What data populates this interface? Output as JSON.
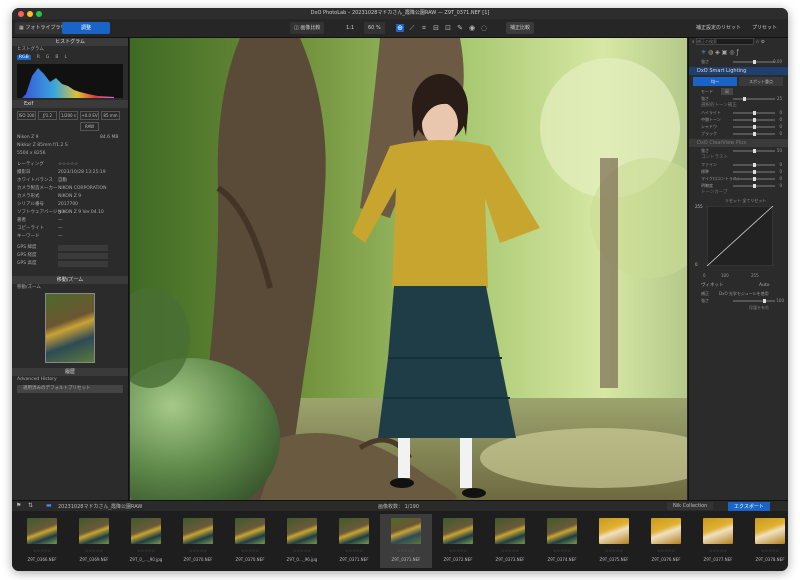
{
  "window": {
    "title": "DxO PhotoLab – 20231028マドカさん_霞降公園RAW — Z9T_0371.NEF [1]"
  },
  "toolbar": {
    "tab_library": "フォトライブラリ",
    "tab_customize": "調整",
    "compare": "画像比較",
    "zoom_fit": "1:1",
    "zoom": "60 %",
    "preview": "補正比較",
    "reset": "補正設定のリセット",
    "presets": "プリセット"
  },
  "left_panel": {
    "histogram_header": "ヒストグラム",
    "histogram_label": "ヒストグラム",
    "channels": [
      "RGB",
      "R",
      "G",
      "B",
      "L"
    ],
    "exif_header": "Exif",
    "exif": {
      "iso": "ISO 100",
      "aperture": "ƒ/1.2",
      "shutter": "1/200 s",
      "ev": "+0.0 EV",
      "focal": "85 mm",
      "format": "RAW"
    },
    "camera": "Nikon Z 9",
    "filesize": "84.6 MB",
    "lens": "Nikkor Z 85mm f/1.2 S",
    "dims": "5504 x 8256",
    "meta": [
      {
        "k": "レーティング",
        "v": "☆☆☆☆☆"
      },
      {
        "k": "撮影日",
        "v": "2023/10/28 13:25:19"
      },
      {
        "k": "ホワイトバランス",
        "v": "自動"
      },
      {
        "k": "カメラ製造メーカー",
        "v": "NIKON CORPORATION"
      },
      {
        "k": "カメラ形式",
        "v": "NIKON Z 9"
      },
      {
        "k": "シリアル番号",
        "v": "2017700"
      },
      {
        "k": "ソフトウェアバージョン",
        "v": "NIKON Z 9 Ver.04.10"
      },
      {
        "k": "著者",
        "v": "—"
      },
      {
        "k": "コピーライト",
        "v": "—"
      },
      {
        "k": "キーワード",
        "v": "—"
      }
    ],
    "gps": [
      "GPS 緯度",
      "GPS 経度",
      "GPS 高度"
    ],
    "move_zoom_header": "移動/ズーム",
    "move_zoom_label": "移動/ズーム",
    "history_header": "履歴",
    "history_group": "Advanced History",
    "history_item": "適用済みのデフォルトプリセット"
  },
  "right_panel": {
    "search_placeholder": "補正の検索",
    "top_rows": [
      {
        "label": "強さ",
        "value": "0.00"
      }
    ],
    "smart_lighting": "DxO Smart Lighting",
    "smart_tabs": [
      "均一",
      "スポット重点"
    ],
    "smart_mode": "モード",
    "smart_mode_value": "弱",
    "smart_strength_label": "強さ",
    "smart_strength": "25",
    "selective_header": "選択的トーン補正",
    "selective_rows": [
      {
        "label": "ハイライト",
        "value": "0"
      },
      {
        "label": "中間トーン",
        "value": "0"
      },
      {
        "label": "シャドウ",
        "value": "0"
      },
      {
        "label": "ブラック",
        "value": "0"
      }
    ],
    "contrast_header": "DxO ClearView Plus",
    "contrast_strength_label": "強さ",
    "contrast_strength": "50",
    "contrast_group": "コントラスト",
    "contrast_rows": [
      {
        "label": "ファイン",
        "value": "0"
      },
      {
        "label": "標準",
        "value": "0"
      },
      {
        "label": "マイクロコントラスト",
        "value": "0"
      },
      {
        "label": "明瞭度",
        "value": "0"
      }
    ],
    "curve_header": "トーンカーブ",
    "curve_reset": "リセット",
    "curve_reset_all": "全てリセット",
    "curve_values": [
      "255",
      "0",
      "0",
      "255",
      "100",
      "255"
    ],
    "vignette_header": "ヴィネット",
    "vignette_mode": "Auto",
    "vignette_correction": "補正",
    "vignette_correction_value": "DxO 光学モジュールを使用",
    "vignette_strength_label": "強さ",
    "vignette_strength": "100",
    "vignette_protect": "保護を有効"
  },
  "filmbar": {
    "folder": "20231028マドカさん_霞降公園RAW",
    "count_label": "画像枚数：",
    "count": "1/190",
    "nik": "Nik Collection",
    "export": "エクスポート"
  },
  "filmstrip": [
    {
      "name": "Z9T_0366.NEF",
      "kind": "g"
    },
    {
      "name": "Z9T_0369.NEF",
      "kind": "g"
    },
    {
      "name": "Z9T_0_..._90.jpg",
      "kind": "g"
    },
    {
      "name": "Z9T_0370.NEF",
      "kind": "g"
    },
    {
      "name": "Z9T_0370.NEF",
      "kind": "g"
    },
    {
      "name": "Z9T_0..._96.jpg",
      "kind": "g"
    },
    {
      "name": "Z9T_0371.NEF",
      "kind": "g"
    },
    {
      "name": "Z9T_0371.NEF",
      "kind": "s"
    },
    {
      "name": "Z9T_0372.NEF",
      "kind": "g"
    },
    {
      "name": "Z9T_0373.NEF",
      "kind": "g"
    },
    {
      "name": "Z9T_0374.NEF",
      "kind": "g"
    },
    {
      "name": "Z9T_0375.NEF",
      "kind": "y"
    },
    {
      "name": "Z9T_0376.NEF",
      "kind": "y"
    },
    {
      "name": "Z9T_0377.NEF",
      "kind": "y"
    },
    {
      "name": "Z9T_0378.NEF",
      "kind": "y"
    }
  ],
  "colors": {
    "accent": "#1a63c7",
    "histogram_bg": "#111111"
  },
  "icons": [
    "search-icon",
    "star-icon",
    "grid-icon",
    "crop-icon",
    "settings-icon"
  ]
}
